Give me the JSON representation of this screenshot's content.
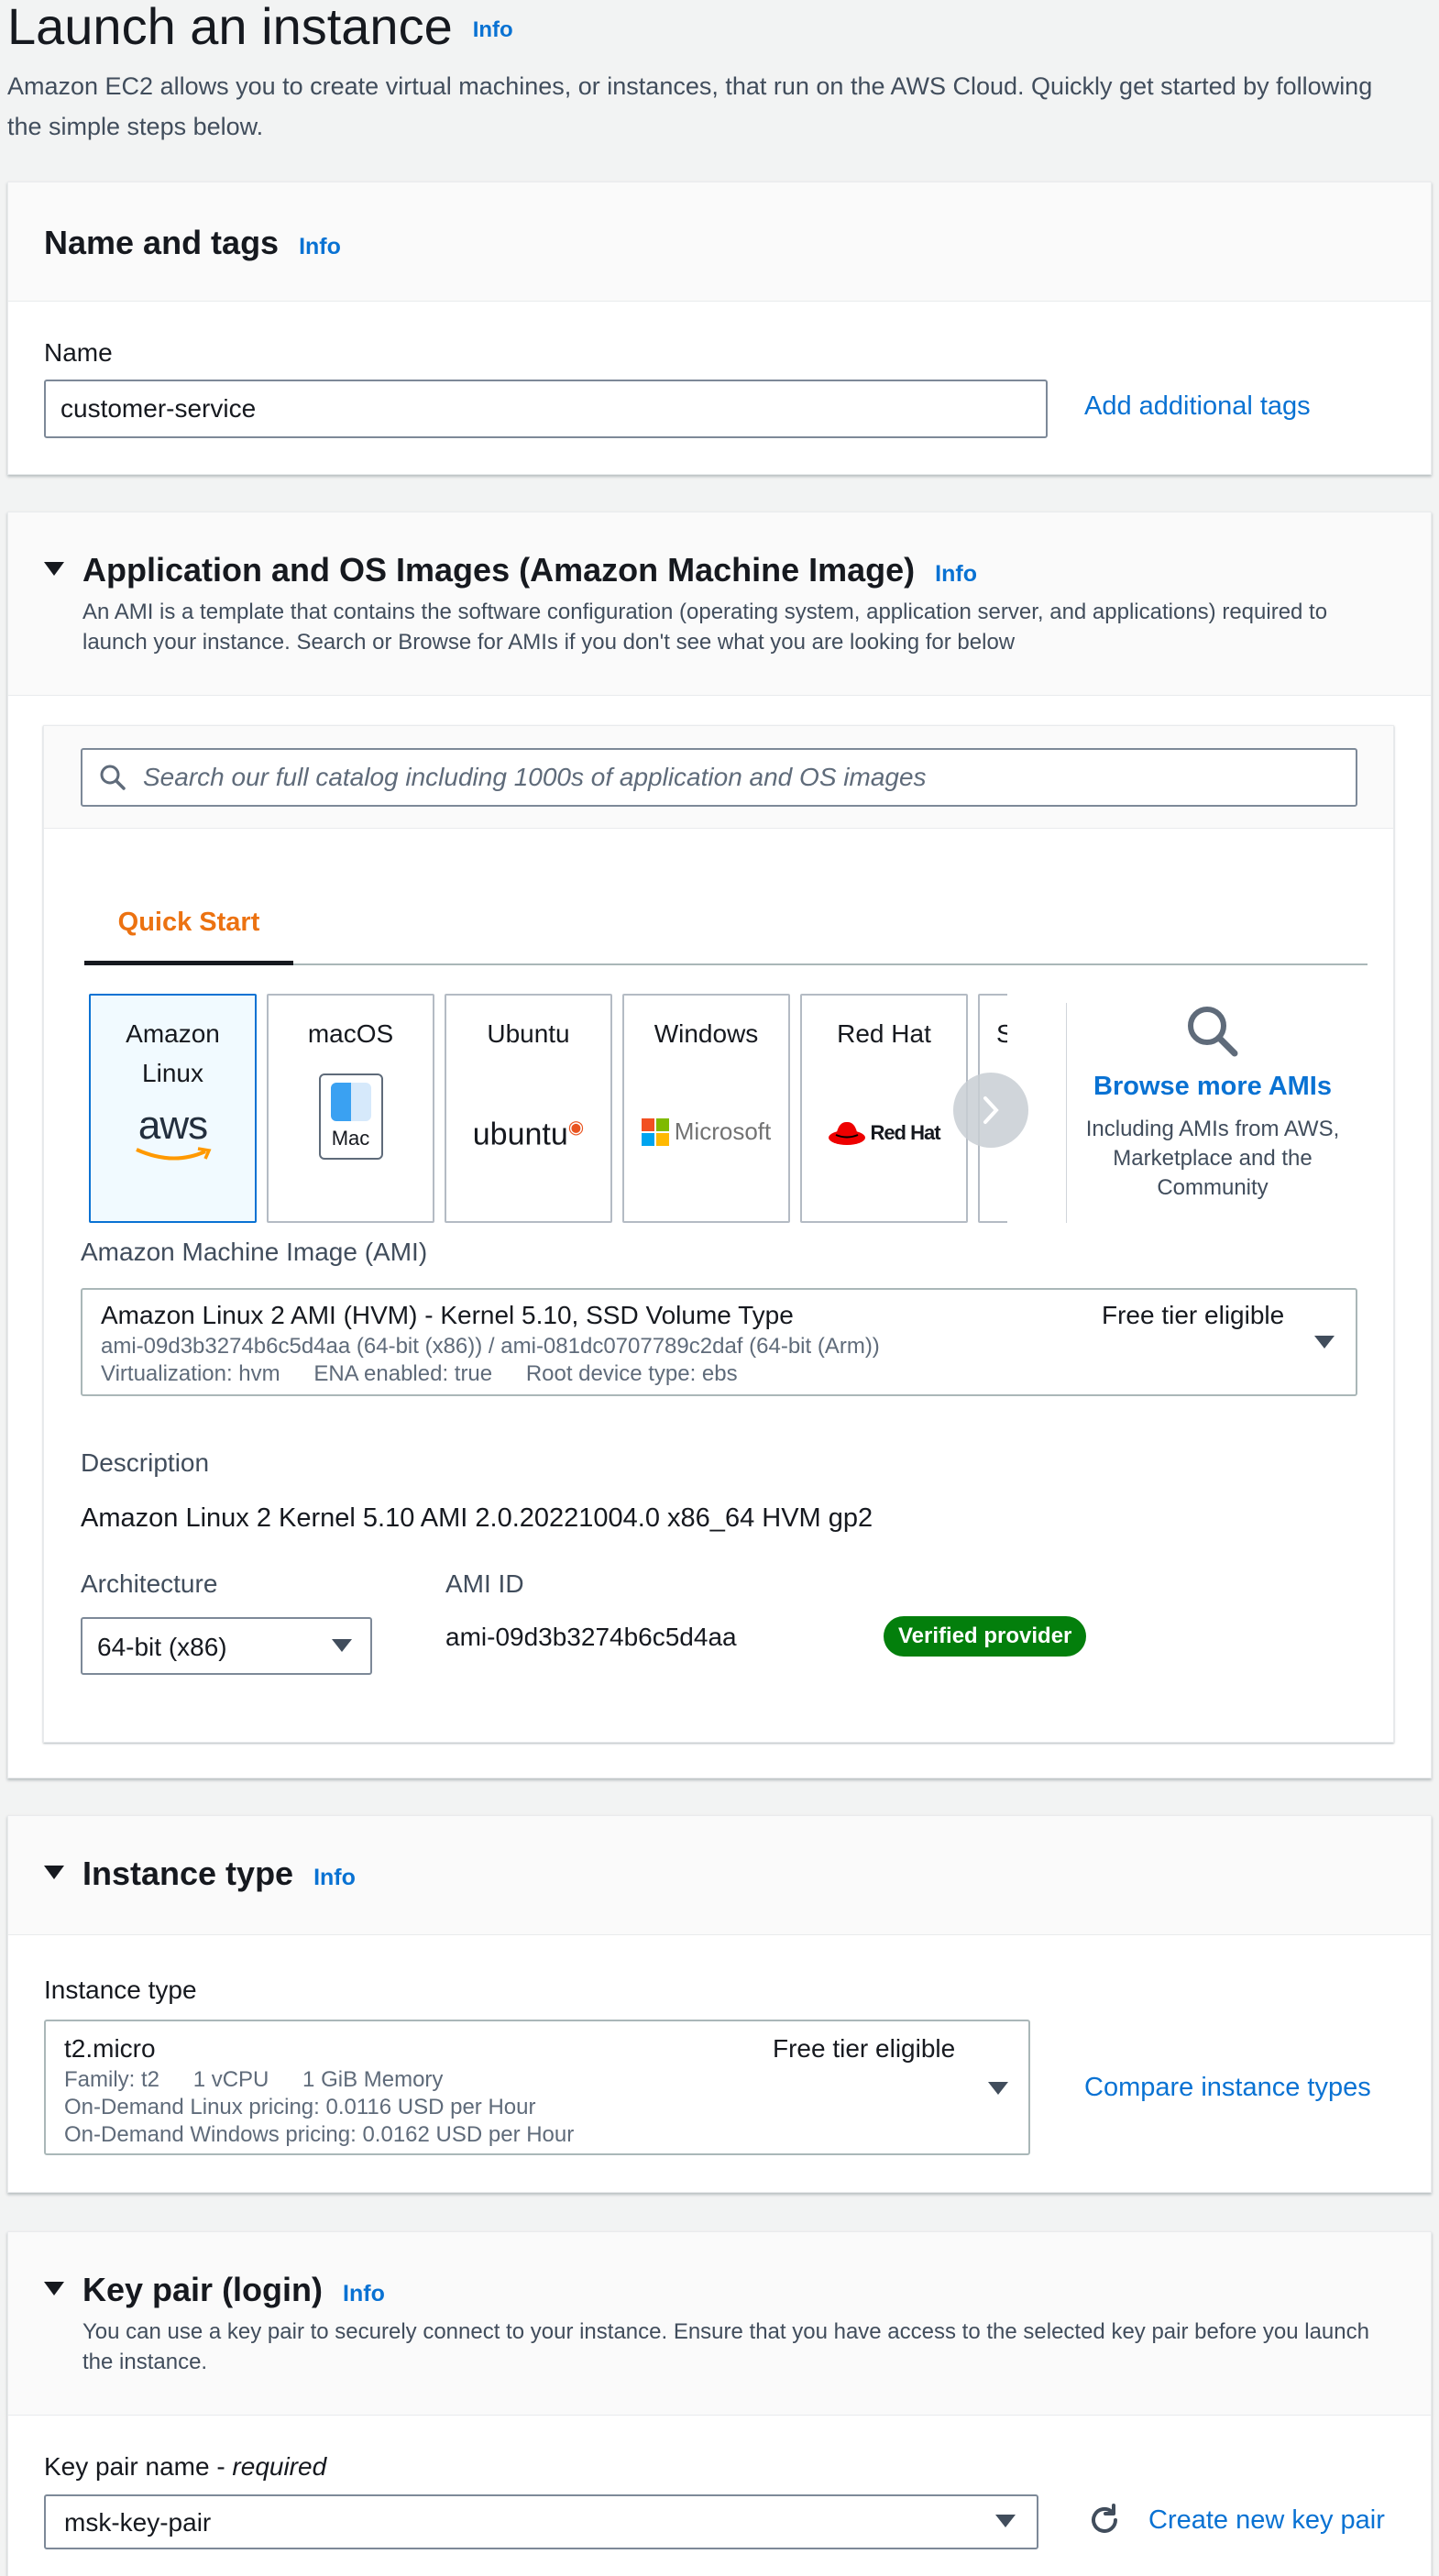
{
  "header": {
    "title": "Launch an instance",
    "info": "Info",
    "description": "Amazon EC2 allows you to create virtual machines, or instances, that run on the AWS Cloud. Quickly get started by following the simple steps below."
  },
  "name_tags": {
    "title": "Name and tags",
    "info": "Info",
    "name_label": "Name",
    "name_value": "customer-service",
    "add_tags_link": "Add additional tags"
  },
  "ami": {
    "title": "Application and OS Images (Amazon Machine Image)",
    "info": "Info",
    "description": "An AMI is a template that contains the software configuration (operating system, application server, and applications) required to launch your instance. Search or Browse for AMIs if you don't see what you are looking for below",
    "search_placeholder": "Search our full catalog including 1000s of application and OS images",
    "tab_quick_start": "Quick Start",
    "tiles": [
      {
        "label": "Amazon Linux",
        "logo": "aws"
      },
      {
        "label": "macOS",
        "logo": "Mac"
      },
      {
        "label": "Ubuntu",
        "logo": "ubuntu"
      },
      {
        "label": "Windows",
        "logo": "Microsoft"
      },
      {
        "label": "Red Hat",
        "logo": "Red Hat"
      },
      {
        "label": "S",
        "logo": ""
      }
    ],
    "browse_more": "Browse more AMIs",
    "browse_more_sub": "Including AMIs from AWS, Marketplace and the Community",
    "ami_label": "Amazon Machine Image (AMI)",
    "selected_ami": {
      "name": "Amazon Linux 2 AMI (HVM) - Kernel 5.10, SSD Volume Type",
      "badge": "Free tier eligible",
      "ids": "ami-09d3b3274b6c5d4aa (64-bit (x86)) / ami-081dc0707789c2daf (64-bit (Arm))",
      "virtualization": "Virtualization: hvm",
      "ena": "ENA enabled: true",
      "root_device": "Root device type: ebs"
    },
    "description_label": "Description",
    "description_value": "Amazon Linux 2 Kernel 5.10 AMI 2.0.20221004.0 x86_64 HVM gp2",
    "architecture_label": "Architecture",
    "architecture_value": "64-bit (x86)",
    "ami_id_label": "AMI ID",
    "ami_id_value": "ami-09d3b3274b6c5d4aa",
    "verified_badge": "Verified provider"
  },
  "instance_type": {
    "title": "Instance type",
    "info": "Info",
    "label": "Instance type",
    "value": "t2.micro",
    "badge": "Free tier eligible",
    "family": "Family: t2",
    "vcpu": "1 vCPU",
    "memory": "1 GiB Memory",
    "linux_pricing": "On-Demand Linux pricing: 0.0116 USD per Hour",
    "windows_pricing": "On-Demand Windows pricing: 0.0162 USD per Hour",
    "compare_link": "Compare instance types"
  },
  "key_pair": {
    "title": "Key pair (login)",
    "info": "Info",
    "description": "You can use a key pair to securely connect to your instance. Ensure that you have access to the selected key pair before you launch the instance.",
    "label": "Key pair name -",
    "label_required": "required",
    "value": "msk-key-pair",
    "create_link": "Create new key pair"
  },
  "colors": {
    "accent": "#0972d3",
    "tab_active": "#ec7211",
    "badge_green": "#037f0c"
  }
}
